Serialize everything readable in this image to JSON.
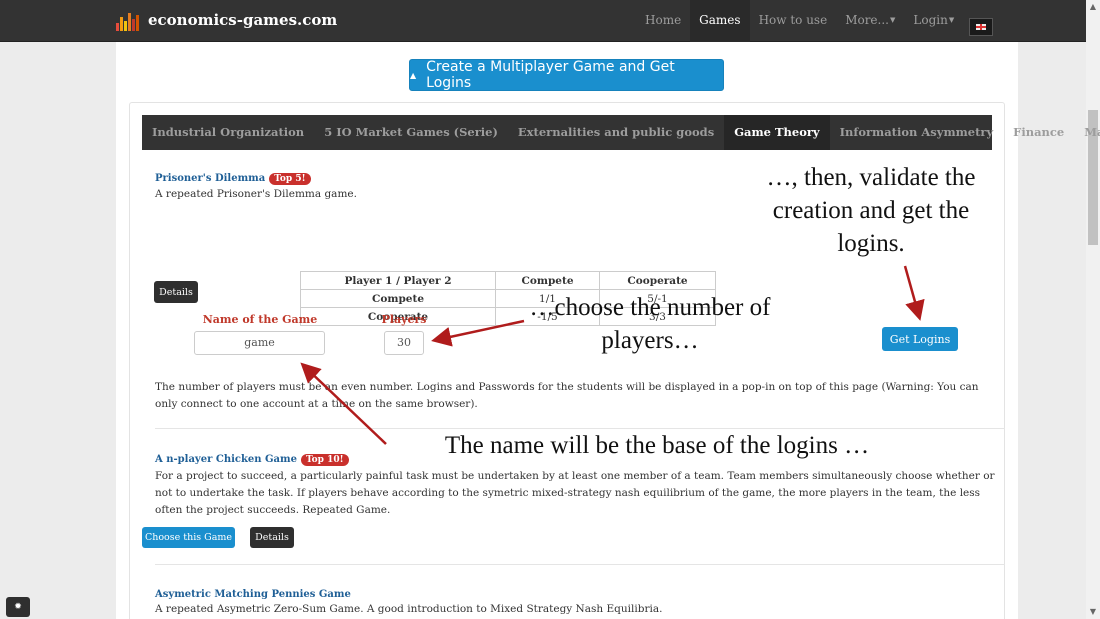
{
  "navbar": {
    "brand": "economics-games.com",
    "items": [
      "Home",
      "Games",
      "How to use",
      "More...",
      "Login"
    ],
    "flag_icon": "uk-flag-icon"
  },
  "create_button": "Create a Multiplayer Game and Get Logins",
  "tabs": [
    "Industrial Organization",
    "5 IO Market Games (Serie)",
    "Externalities and public goods",
    "Game Theory",
    "Information Asymmetry",
    "Finance",
    "Macro"
  ],
  "active_tab": "Game Theory",
  "games": [
    {
      "title": "Prisoner's Dilemma",
      "badge": "Top 5!",
      "desc": "A repeated Prisoner's Dilemma game.",
      "payoff": {
        "header": [
          "Player 1 / Player 2",
          "Compete",
          "Cooperate"
        ],
        "rows": [
          [
            "Compete",
            "1/1",
            "5/-1"
          ],
          [
            "Cooperate",
            "-1/5",
            "3/3"
          ]
        ]
      },
      "details": "Details",
      "name_label": "Name of the Game",
      "name_value": "game",
      "players_label": "Players",
      "players_value": "30",
      "get_logins": "Get Logins",
      "note": "The number of players must be an even number. Logins and Passwords for the students will be displayed in a pop-in on top of this page (Warning: You can only connect to one account at a time on the same browser)."
    },
    {
      "title": "A n-player Chicken Game",
      "badge": "Top 10!",
      "desc": "For a project to succeed, a particularly painful task must be undertaken by at least one member of a team. Team members simultaneously choose whether or not to undertake the task. If players behave according to the symetric mixed-strategy nash equilibrium of the game, the more players in the team, the less often the project succeeds. Repeated Game.",
      "choose": "Choose this Game",
      "details": "Details"
    },
    {
      "title": "Asymetric Matching Pennies Game",
      "desc": "A repeated Asymetric Zero-Sum Game. A good introduction to Mixed Strategy Nash Equilibria."
    }
  ],
  "annotations": {
    "validate": "…, then, validate the creation and get the logins.",
    "players": "…choose the number of players…",
    "name": "The name will be the base of the logins …"
  },
  "colors": {
    "accent": "#1a8fce",
    "badge": "#c9302c",
    "navbar": "#333333",
    "arrow": "#b01c1c"
  }
}
